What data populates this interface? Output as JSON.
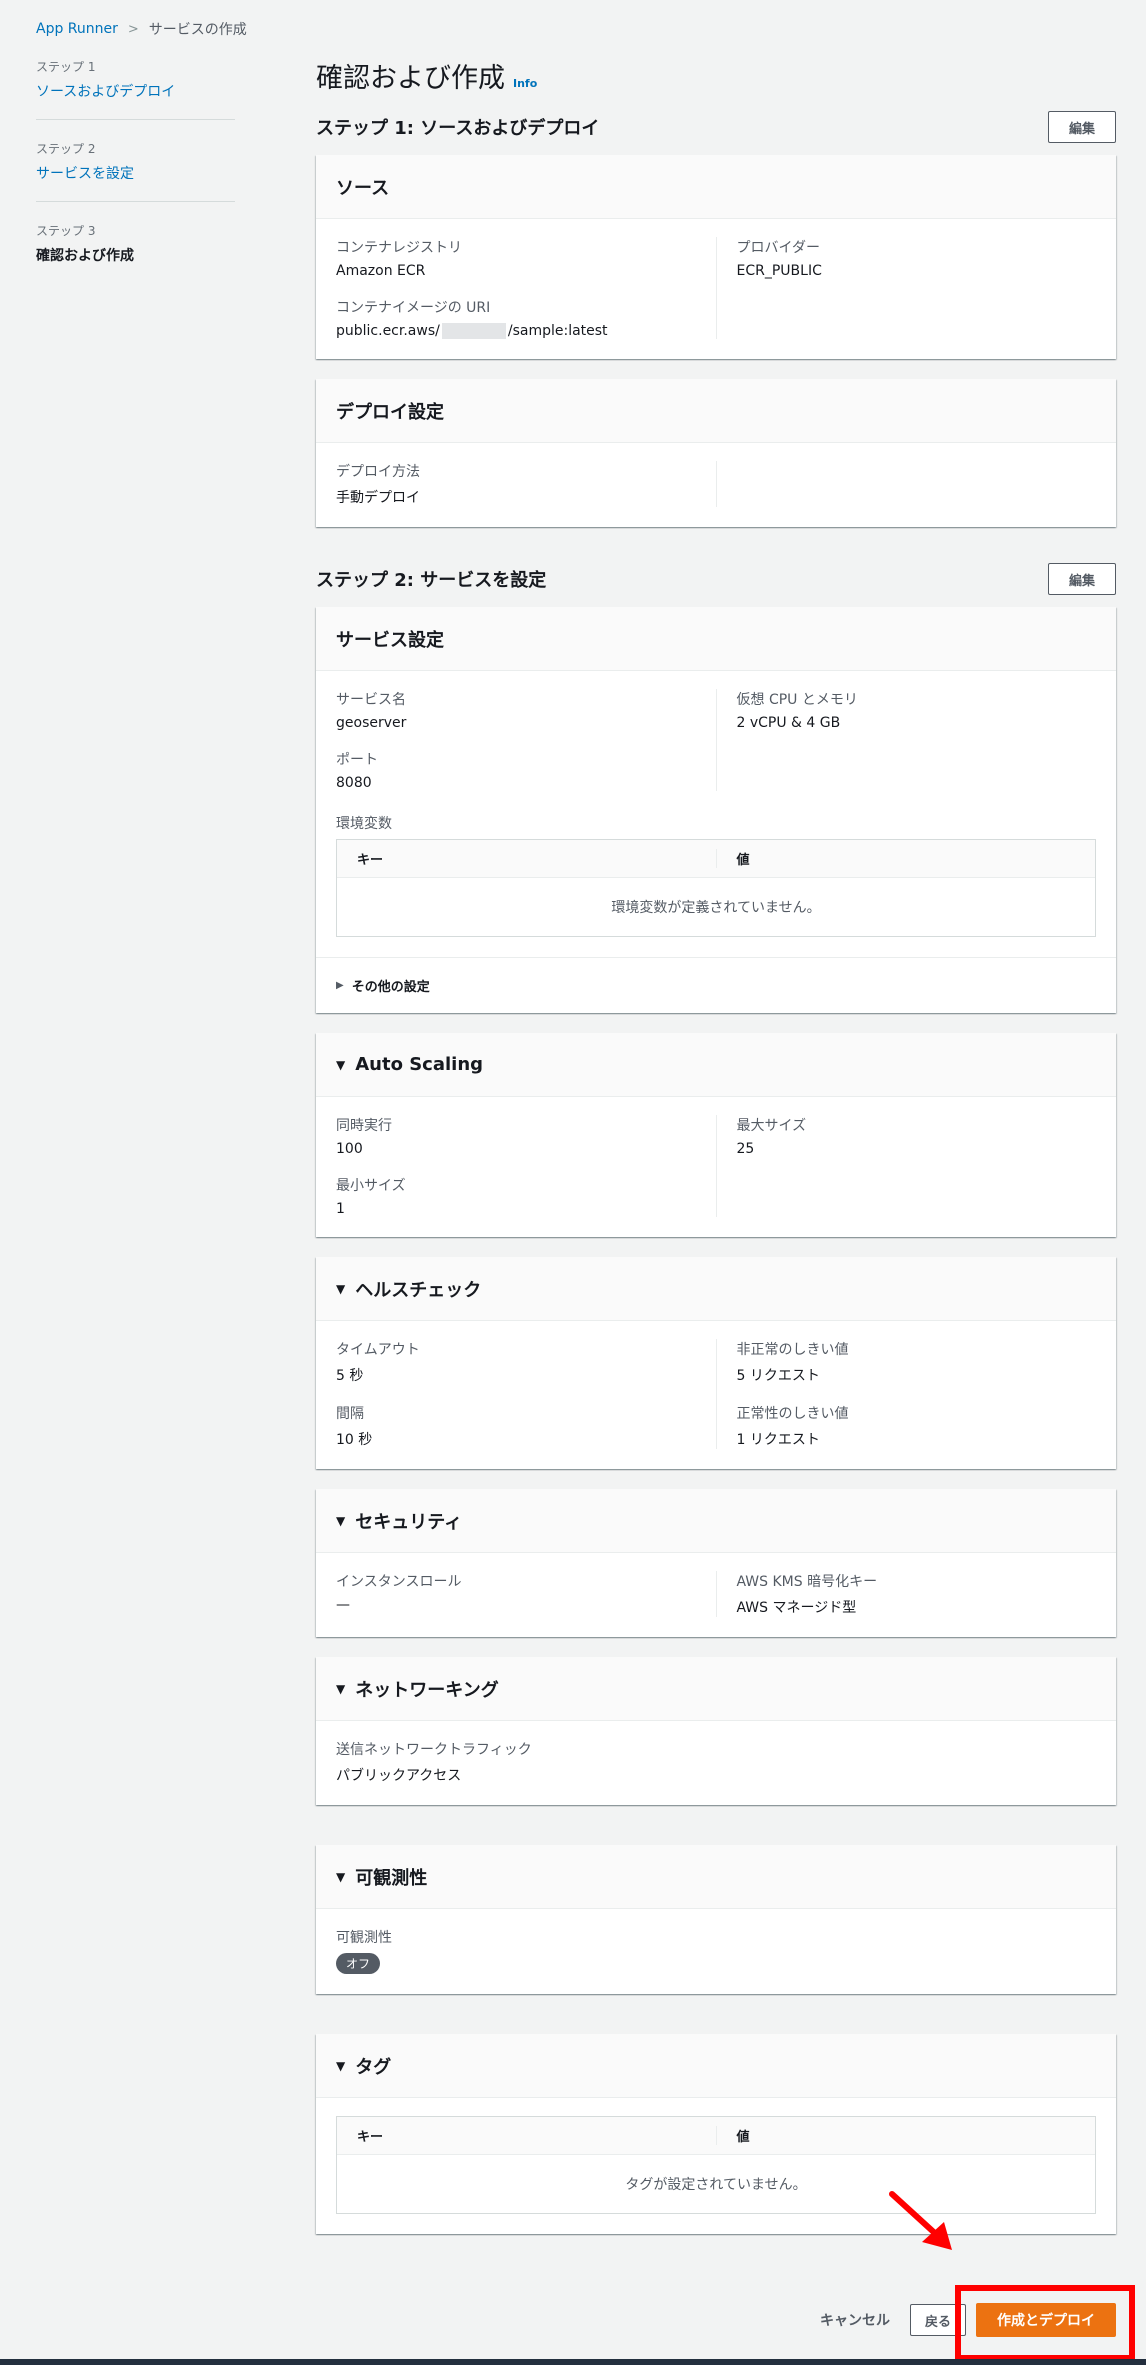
{
  "breadcrumb": {
    "root": "App Runner",
    "current": "サービスの作成"
  },
  "steps": [
    {
      "label": "ステップ 1",
      "name": "ソースおよびデプロイ"
    },
    {
      "label": "ステップ 2",
      "name": "サービスを設定"
    },
    {
      "label": "ステップ 3",
      "name": "確認および作成"
    }
  ],
  "page": {
    "title": "確認および作成",
    "info": "Info"
  },
  "step1": {
    "title": "ステップ 1: ソースおよびデプロイ",
    "edit": "編集",
    "source": {
      "title": "ソース",
      "registry_key": "コンテナレジストリ",
      "registry_val": "Amazon ECR",
      "uri_key": "コンテナイメージの URI",
      "uri_prefix": "public.ecr.aws/",
      "uri_suffix": "/sample:latest",
      "provider_key": "プロバイダー",
      "provider_val": "ECR_PUBLIC"
    },
    "deploy": {
      "title": "デプロイ設定",
      "method_key": "デプロイ方法",
      "method_val": "手動デプロイ"
    }
  },
  "step2": {
    "title": "ステップ 2: サービスを設定",
    "edit": "編集",
    "service": {
      "title": "サービス設定",
      "name_key": "サービス名",
      "name_val": "geoserver",
      "port_key": "ポート",
      "port_val": "8080",
      "cpu_key": "仮想 CPU とメモリ",
      "cpu_val": "2 vCPU & 4 GB",
      "env_label": "環境変数",
      "env_col_key": "キー",
      "env_col_val": "値",
      "env_empty": "環境変数が定義されていません。",
      "other": "その他の設定"
    },
    "autoscaling": {
      "title": "Auto Scaling",
      "concurrency_key": "同時実行",
      "concurrency_val": "100",
      "min_key": "最小サイズ",
      "min_val": "1",
      "max_key": "最大サイズ",
      "max_val": "25"
    },
    "health": {
      "title": "ヘルスチェック",
      "timeout_key": "タイムアウト",
      "timeout_val": "5 秒",
      "interval_key": "間隔",
      "interval_val": "10 秒",
      "unhealthy_key": "非正常のしきい値",
      "unhealthy_val": "5 リクエスト",
      "healthy_key": "正常性のしきい値",
      "healthy_val": "1 リクエスト"
    },
    "security": {
      "title": "セキュリティ",
      "role_key": "インスタンスロール",
      "role_val": "—",
      "kms_key": "AWS KMS 暗号化キー",
      "kms_val": "AWS マネージド型"
    },
    "networking": {
      "title": "ネットワーキング",
      "traffic_key": "送信ネットワークトラフィック",
      "traffic_val": "パブリックアクセス"
    },
    "observability": {
      "title": "可観測性",
      "key": "可観測性",
      "badge": "オフ"
    },
    "tags": {
      "title": "タグ",
      "col_key": "キー",
      "col_val": "値",
      "empty": "タグが設定されていません。"
    }
  },
  "actions": {
    "cancel": "キャンセル",
    "back": "戻る",
    "create": "作成とデプロイ"
  },
  "colors": {
    "primary": "#ec7211",
    "link": "#0073bb",
    "highlight": "#ff0000"
  }
}
